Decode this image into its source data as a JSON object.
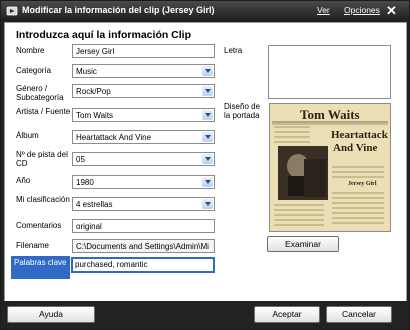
{
  "window": {
    "title": "Modificar la información del clip (Jersey Girl)",
    "menu": [
      "Ver",
      "Opciones"
    ],
    "close_glyph": "✕"
  },
  "form": {
    "heading": "Introduzca aquí la información Clip",
    "fields": {
      "nombre": {
        "label": "Nombre",
        "value": "Jersey Girl"
      },
      "categoria": {
        "label": "Categoría",
        "value": "Music"
      },
      "genero": {
        "label": "Género / Subcategoría",
        "value": "Rock/Pop"
      },
      "artista": {
        "label": "Artista / Fuente",
        "value": "Tom Waits"
      },
      "album": {
        "label": "Álbum",
        "value": "Heartattack And Vine"
      },
      "pista": {
        "label": "Nº de pista del CD",
        "value": "05"
      },
      "anio": {
        "label": "Año",
        "value": "1980"
      },
      "clasificacion": {
        "label": "Mi clasificación",
        "value": "4 estrellas"
      },
      "comentarios": {
        "label": "Comentarios",
        "value": "original"
      },
      "filename": {
        "label": "Filename",
        "value": "C:\\Documents and Settings\\Admin\\Mi"
      },
      "palabras": {
        "label": "Palabras clave",
        "value": "purchased, romantic"
      }
    }
  },
  "right_panel": {
    "lyrics_label": "Letra",
    "cover_label": "Diseño de la portada",
    "cover": {
      "artist": "Tom Waits",
      "title_line1": "Heartattack",
      "title_line2": "And Vine",
      "small_caption": "Jersey Girl"
    },
    "browse_button": "Examinar"
  },
  "footer": {
    "help_button": "Ayuda",
    "ok_button": "Aceptar",
    "cancel_button": "Cancelar"
  },
  "colors": {
    "title_bar": "#2a2a2a",
    "selection_blue": "#3169c6",
    "dropdown_arrow": "#2f4f7f"
  }
}
